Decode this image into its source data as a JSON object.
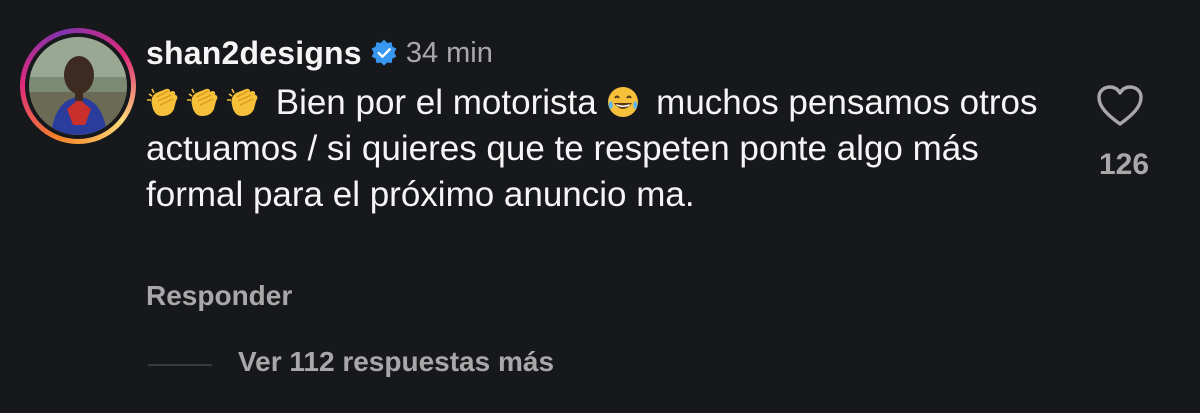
{
  "comment": {
    "username": "shan2designs",
    "verified_icon": "verified-badge-icon",
    "time": "34 min",
    "text_after_emojis": " Bien por el motorista ",
    "text_rest": " muchos pensamos otros actuamos / si quieres que te respeten ponte algo más formal para el próximo anuncio ma.",
    "emojis": [
      "clapping-hands-emoji",
      "clapping-hands-emoji",
      "clapping-hands-emoji",
      "tears-of-joy-emoji"
    ],
    "like_icon": "heart-icon",
    "like_count": "126",
    "reply_label": "Responder",
    "view_more_label": "Ver 112 respuestas más"
  },
  "colors": {
    "background": "#16181c",
    "text_primary": "#f5f5f5",
    "text_secondary": "#a8a8a8",
    "verified": "#3897f0"
  }
}
